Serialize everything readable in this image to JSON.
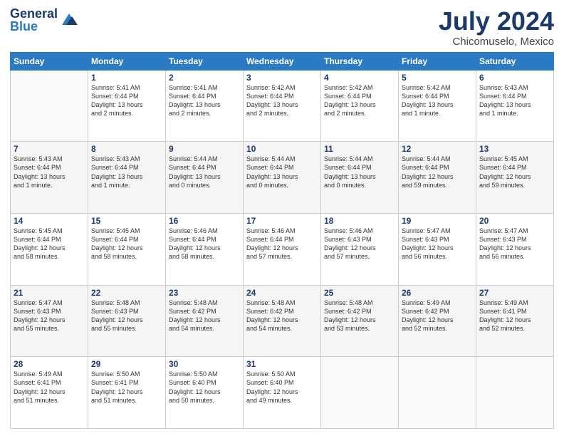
{
  "header": {
    "logo_line1": "General",
    "logo_line2": "Blue",
    "month": "July 2024",
    "location": "Chicomuselo, Mexico"
  },
  "weekdays": [
    "Sunday",
    "Monday",
    "Tuesday",
    "Wednesday",
    "Thursday",
    "Friday",
    "Saturday"
  ],
  "weeks": [
    [
      {
        "day": "",
        "info": ""
      },
      {
        "day": "1",
        "info": "Sunrise: 5:41 AM\nSunset: 6:44 PM\nDaylight: 13 hours\nand 2 minutes."
      },
      {
        "day": "2",
        "info": "Sunrise: 5:41 AM\nSunset: 6:44 PM\nDaylight: 13 hours\nand 2 minutes."
      },
      {
        "day": "3",
        "info": "Sunrise: 5:42 AM\nSunset: 6:44 PM\nDaylight: 13 hours\nand 2 minutes."
      },
      {
        "day": "4",
        "info": "Sunrise: 5:42 AM\nSunset: 6:44 PM\nDaylight: 13 hours\nand 2 minutes."
      },
      {
        "day": "5",
        "info": "Sunrise: 5:42 AM\nSunset: 6:44 PM\nDaylight: 13 hours\nand 1 minute."
      },
      {
        "day": "6",
        "info": "Sunrise: 5:43 AM\nSunset: 6:44 PM\nDaylight: 13 hours\nand 1 minute."
      }
    ],
    [
      {
        "day": "7",
        "info": "Sunrise: 5:43 AM\nSunset: 6:44 PM\nDaylight: 13 hours\nand 1 minute."
      },
      {
        "day": "8",
        "info": "Sunrise: 5:43 AM\nSunset: 6:44 PM\nDaylight: 13 hours\nand 1 minute."
      },
      {
        "day": "9",
        "info": "Sunrise: 5:44 AM\nSunset: 6:44 PM\nDaylight: 13 hours\nand 0 minutes."
      },
      {
        "day": "10",
        "info": "Sunrise: 5:44 AM\nSunset: 6:44 PM\nDaylight: 13 hours\nand 0 minutes."
      },
      {
        "day": "11",
        "info": "Sunrise: 5:44 AM\nSunset: 6:44 PM\nDaylight: 13 hours\nand 0 minutes."
      },
      {
        "day": "12",
        "info": "Sunrise: 5:44 AM\nSunset: 6:44 PM\nDaylight: 12 hours\nand 59 minutes."
      },
      {
        "day": "13",
        "info": "Sunrise: 5:45 AM\nSunset: 6:44 PM\nDaylight: 12 hours\nand 59 minutes."
      }
    ],
    [
      {
        "day": "14",
        "info": "Sunrise: 5:45 AM\nSunset: 6:44 PM\nDaylight: 12 hours\nand 58 minutes."
      },
      {
        "day": "15",
        "info": "Sunrise: 5:45 AM\nSunset: 6:44 PM\nDaylight: 12 hours\nand 58 minutes."
      },
      {
        "day": "16",
        "info": "Sunrise: 5:46 AM\nSunset: 6:44 PM\nDaylight: 12 hours\nand 58 minutes."
      },
      {
        "day": "17",
        "info": "Sunrise: 5:46 AM\nSunset: 6:44 PM\nDaylight: 12 hours\nand 57 minutes."
      },
      {
        "day": "18",
        "info": "Sunrise: 5:46 AM\nSunset: 6:43 PM\nDaylight: 12 hours\nand 57 minutes."
      },
      {
        "day": "19",
        "info": "Sunrise: 5:47 AM\nSunset: 6:43 PM\nDaylight: 12 hours\nand 56 minutes."
      },
      {
        "day": "20",
        "info": "Sunrise: 5:47 AM\nSunset: 6:43 PM\nDaylight: 12 hours\nand 56 minutes."
      }
    ],
    [
      {
        "day": "21",
        "info": "Sunrise: 5:47 AM\nSunset: 6:43 PM\nDaylight: 12 hours\nand 55 minutes."
      },
      {
        "day": "22",
        "info": "Sunrise: 5:48 AM\nSunset: 6:43 PM\nDaylight: 12 hours\nand 55 minutes."
      },
      {
        "day": "23",
        "info": "Sunrise: 5:48 AM\nSunset: 6:42 PM\nDaylight: 12 hours\nand 54 minutes."
      },
      {
        "day": "24",
        "info": "Sunrise: 5:48 AM\nSunset: 6:42 PM\nDaylight: 12 hours\nand 54 minutes."
      },
      {
        "day": "25",
        "info": "Sunrise: 5:48 AM\nSunset: 6:42 PM\nDaylight: 12 hours\nand 53 minutes."
      },
      {
        "day": "26",
        "info": "Sunrise: 5:49 AM\nSunset: 6:42 PM\nDaylight: 12 hours\nand 52 minutes."
      },
      {
        "day": "27",
        "info": "Sunrise: 5:49 AM\nSunset: 6:41 PM\nDaylight: 12 hours\nand 52 minutes."
      }
    ],
    [
      {
        "day": "28",
        "info": "Sunrise: 5:49 AM\nSunset: 6:41 PM\nDaylight: 12 hours\nand 51 minutes."
      },
      {
        "day": "29",
        "info": "Sunrise: 5:50 AM\nSunset: 6:41 PM\nDaylight: 12 hours\nand 51 minutes."
      },
      {
        "day": "30",
        "info": "Sunrise: 5:50 AM\nSunset: 6:40 PM\nDaylight: 12 hours\nand 50 minutes."
      },
      {
        "day": "31",
        "info": "Sunrise: 5:50 AM\nSunset: 6:40 PM\nDaylight: 12 hours\nand 49 minutes."
      },
      {
        "day": "",
        "info": ""
      },
      {
        "day": "",
        "info": ""
      },
      {
        "day": "",
        "info": ""
      }
    ]
  ]
}
